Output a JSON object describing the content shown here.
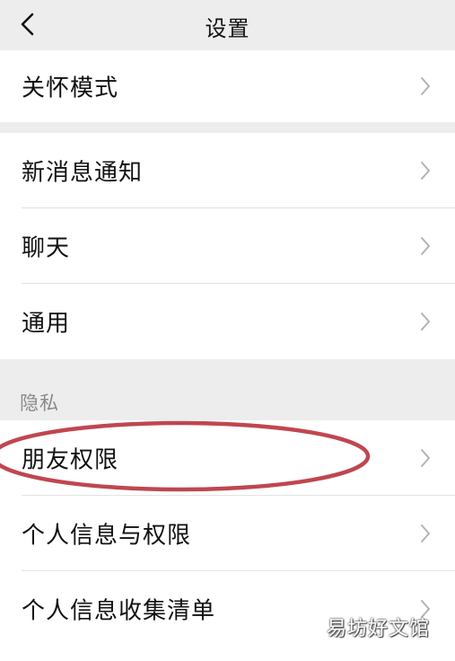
{
  "header": {
    "title": "设置"
  },
  "groups": [
    {
      "items": [
        {
          "label": "关怀模式"
        }
      ]
    },
    {
      "items": [
        {
          "label": "新消息通知"
        },
        {
          "label": "聊天"
        },
        {
          "label": "通用"
        }
      ]
    },
    {
      "section_title": "隐私",
      "items": [
        {
          "label": "朋友权限"
        },
        {
          "label": "个人信息与权限"
        },
        {
          "label": "个人信息收集清单"
        }
      ]
    }
  ],
  "annotation": {
    "color": "#c0464f",
    "target": "朋友权限"
  },
  "watermark": {
    "text": "易坊好文馆"
  },
  "colors": {
    "background": "#ededed",
    "cell": "#ffffff",
    "chevron": "#b3b3b3"
  }
}
